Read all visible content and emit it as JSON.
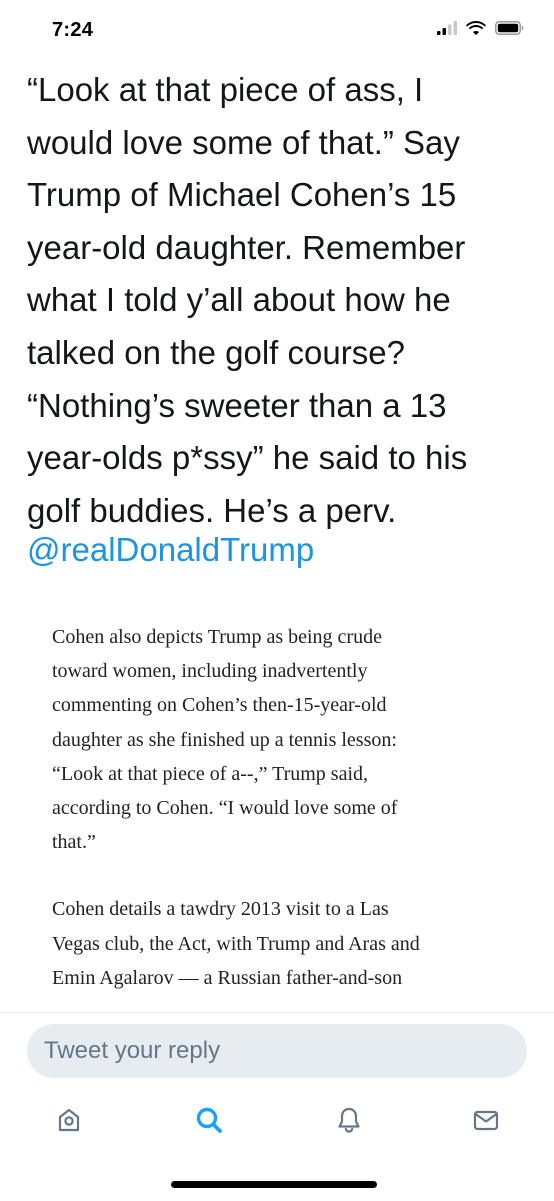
{
  "status_bar": {
    "time": "7:24",
    "icons": [
      "cellular-signal-icon",
      "wifi-icon",
      "battery-icon"
    ]
  },
  "tweet": {
    "text": "“Look at that piece of ass, I\nwould love some of that.” Say\nTrump of Michael Cohen’s 15\nyear-old daughter. Remember\nwhat I told y’all about how he\ntalked on the golf course?\n“Nothing’s sweeter than a 13\nyear-olds p*ssy” he said to his\ngolf buddies. He’s a perv.",
    "mention": "@realDonaldTrump"
  },
  "article_image": {
    "paragraphs": [
      "Cohen also depicts Trump as being crude\ntoward women, including inadvertently\ncommenting on Cohen’s then-15-year-old\ndaughter as she finished up a tennis lesson:\n“Look at that piece of a--,” Trump said,\naccording to Cohen. “I would love some of\nthat.”",
      "Cohen details a tawdry 2013 visit to a Las\nVegas club, the Act, with Trump and Aras and\nEmin Agalarov — a Russian father-and-son"
    ]
  },
  "reply": {
    "placeholder": "Tweet your reply",
    "value": ""
  },
  "tab_bar": {
    "tabs": [
      {
        "name": "home",
        "icon": "home-icon",
        "active": false
      },
      {
        "name": "search",
        "icon": "search-icon",
        "active": true
      },
      {
        "name": "notifications",
        "icon": "bell-icon",
        "active": false
      },
      {
        "name": "messages",
        "icon": "envelope-icon",
        "active": false
      }
    ]
  },
  "colors": {
    "link": "#1b95e0",
    "text": "#14171a",
    "icon_inactive": "#657786",
    "icon_active": "#1da1f2",
    "input_background": "#e6ecf0"
  }
}
